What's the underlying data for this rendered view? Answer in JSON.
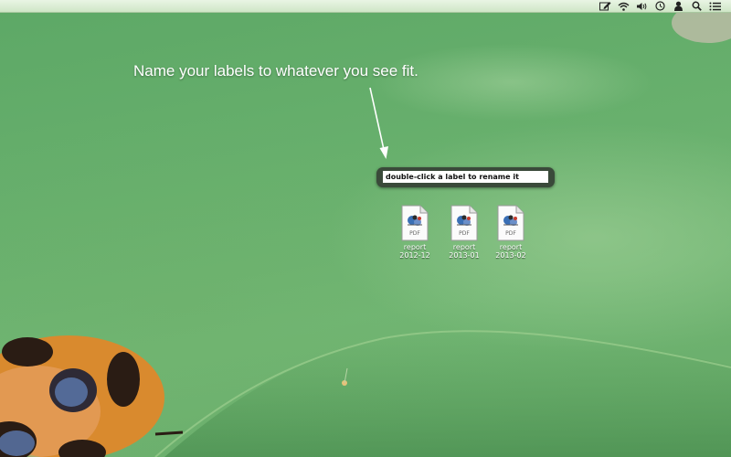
{
  "menubar": {
    "icons": [
      "edit-icon",
      "wifi-icon",
      "volume-icon",
      "clock-icon",
      "user-icon",
      "spotlight-search-icon",
      "list-menu-icon"
    ]
  },
  "caption": "Name your labels to whatever you see fit.",
  "rename": {
    "value": "double-click a label to rename it"
  },
  "files": [
    {
      "badge": "PDF",
      "line1": "report",
      "line2": "2012-12"
    },
    {
      "badge": "PDF",
      "line1": "report",
      "line2": "2013-01"
    },
    {
      "badge": "PDF",
      "line1": "report",
      "line2": "2013-02"
    }
  ],
  "colors": {
    "background_green": "#68b06d",
    "menubar": "#dff0d8",
    "rename_frame": "#3a4a3a"
  }
}
